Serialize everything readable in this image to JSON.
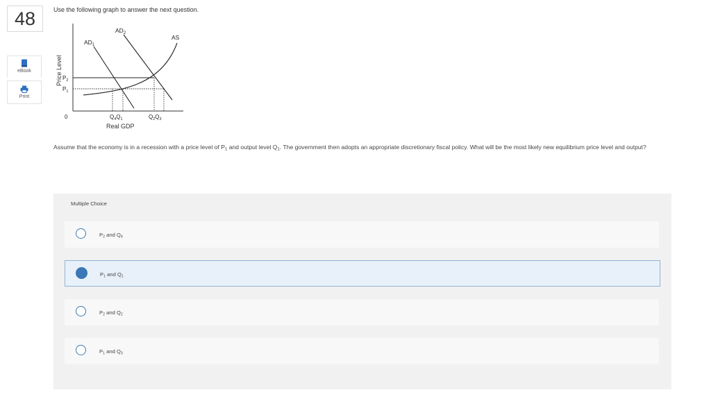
{
  "question_number": "48",
  "toolbar": {
    "ebook_label": "eBook",
    "print_label": "Print"
  },
  "instruction": "Use the following graph to answer the next question.",
  "graph": {
    "y_axis_label": "Price Level",
    "x_axis_label": "Real GDP",
    "origin": "0",
    "curves": {
      "ad1": "AD",
      "ad1_sub": "1",
      "ad2": "AD",
      "ad2_sub": "2",
      "as": "AS"
    },
    "y_ticks": [
      {
        "label": "P",
        "sub": "2"
      },
      {
        "label": "P",
        "sub": "1"
      }
    ],
    "x_ticks": [
      {
        "a": "Q",
        "a_sub": "4",
        "b": "Q",
        "b_sub": "1"
      },
      {
        "a": "Q",
        "a_sub": "2",
        "b": "Q",
        "b_sub": "3"
      }
    ]
  },
  "question": {
    "part1": "Assume that the economy is in a recession with a price level of P",
    "sub1": "1",
    "part2": " and output level Q",
    "sub2": "1",
    "part3": ". The government then adopts an appropriate discretionary fiscal policy. What will be the most likely new equilibrium price level and output?"
  },
  "multiple_choice": {
    "label": "Multiple Choice",
    "options": [
      {
        "p": "P",
        "p_sub": "2",
        "mid": " and ",
        "q": "Q",
        "q_sub": "4",
        "selected": false
      },
      {
        "p": "P",
        "p_sub": "1",
        "mid": " and ",
        "q": "Q",
        "q_sub": "1",
        "selected": true
      },
      {
        "p": "P",
        "p_sub": "2",
        "mid": " and ",
        "q": "Q",
        "q_sub": "2",
        "selected": false
      },
      {
        "p": "P",
        "p_sub": "1",
        "mid": " and ",
        "q": "Q",
        "q_sub": "3",
        "selected": false
      }
    ]
  },
  "colors": {
    "accent": "#3c78b5",
    "selected_bg": "#e8f1fa",
    "panel_bg": "#f1f1f1"
  }
}
